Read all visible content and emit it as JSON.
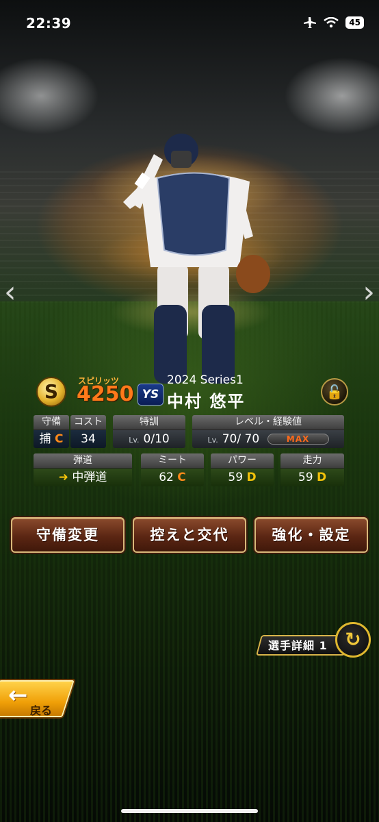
{
  "status_bar": {
    "time": "22:39",
    "battery": "45"
  },
  "player": {
    "spirits_label": "スピリッツ",
    "spirits": "4250",
    "team_logo": "YS",
    "series": "2024 Series1",
    "name": "中村 悠平"
  },
  "stats": {
    "defense": {
      "label": "守備",
      "position": "捕",
      "grade": "C"
    },
    "cost": {
      "label": "コスト",
      "value": "34"
    },
    "training": {
      "label": "特訓",
      "lv": "Lv.",
      "value": "0/10"
    },
    "level": {
      "label": "レベル・経験値",
      "lv": "Lv.",
      "value": "70/ 70",
      "max": "MAX"
    },
    "trajectory": {
      "label": "弾道",
      "value": "中弾道"
    },
    "meet": {
      "label": "ミート",
      "value": "62",
      "grade": "C"
    },
    "power": {
      "label": "パワー",
      "value": "59",
      "grade": "D"
    },
    "speed": {
      "label": "走力",
      "value": "59",
      "grade": "D"
    }
  },
  "buttons": {
    "change_defense": "守備変更",
    "swap_reserve": "控えと交代",
    "enhance": "強化・設定"
  },
  "detail_button": "選手詳細 1",
  "back_button": "戻る",
  "colors": {
    "accent_gold": "#d9b87a",
    "spirits_orange": "#ff7a1a",
    "back_yellow": "#f0a008"
  }
}
